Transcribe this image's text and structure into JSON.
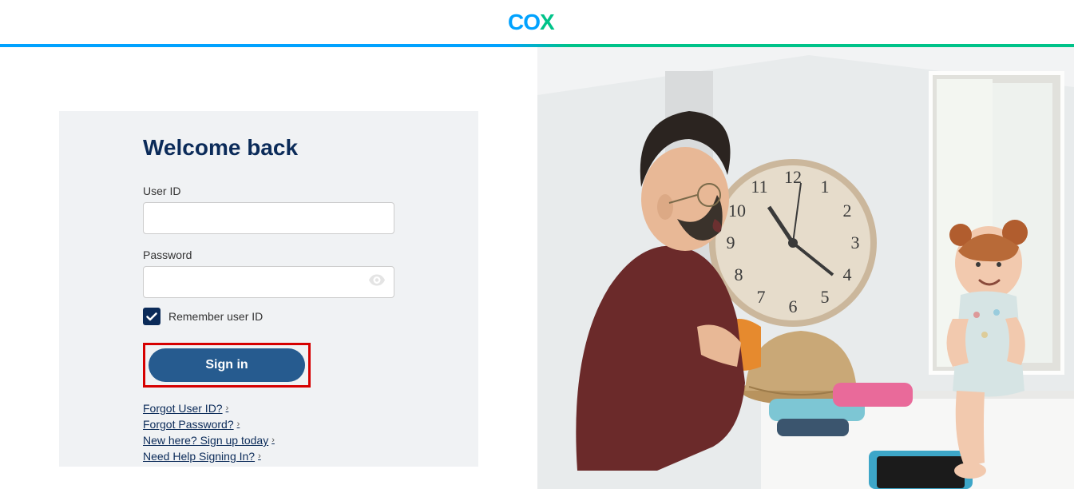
{
  "brand": {
    "name": "COX"
  },
  "login": {
    "title": "Welcome back",
    "user_id_label": "User ID",
    "user_id_value": "",
    "password_label": "Password",
    "password_value": "",
    "remember_label": "Remember user ID",
    "remember_checked": true,
    "signin_label": "Sign in"
  },
  "links": {
    "forgot_user": "Forgot User ID?",
    "forgot_password": "Forgot Password?",
    "signup": "New here? Sign up today",
    "help": "Need Help Signing In?"
  }
}
